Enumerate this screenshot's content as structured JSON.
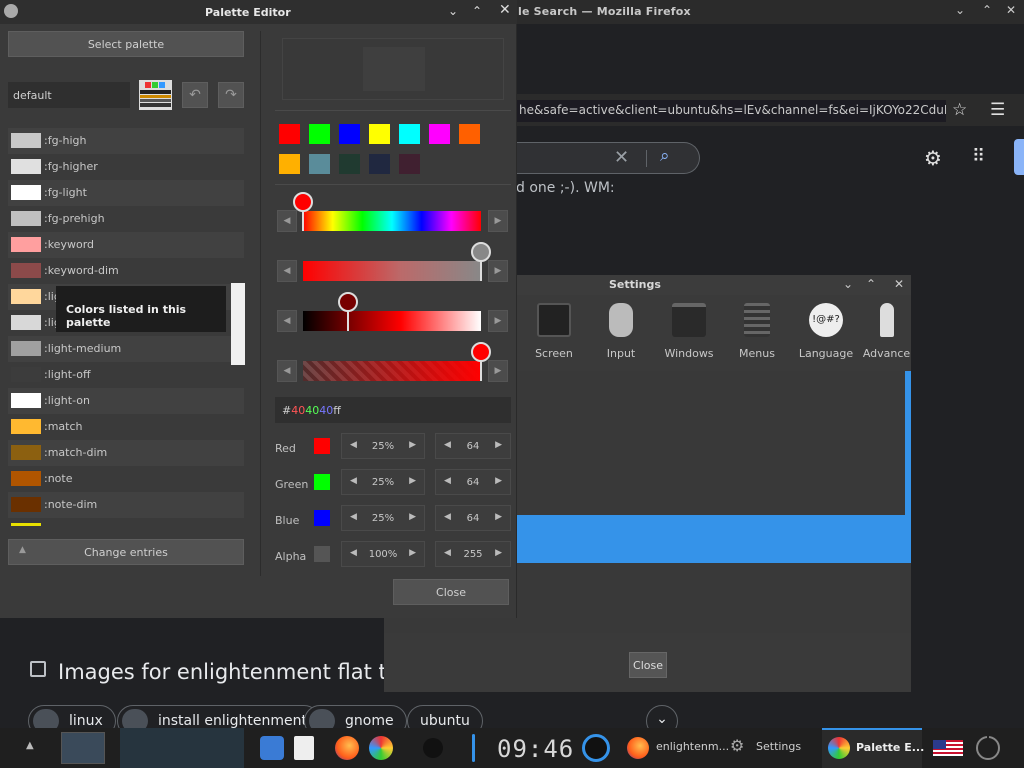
{
  "firefox": {
    "title": "le Search — Mozilla Firefox",
    "url": "he&safe=active&client=ubuntu&hs=lEv&channel=fs&ei=IjKOYo22CduHptQP",
    "body_text": "d one ;-). WM:",
    "images_heading": "Images for enlightenment flat the",
    "chips": [
      "linux",
      "install enlightenment",
      "gnome",
      "ubuntu"
    ]
  },
  "settings": {
    "title": "Settings",
    "items": [
      "Screen",
      "Input",
      "Windows",
      "Menus",
      "Language",
      "Advance"
    ],
    "close_label": "Close"
  },
  "palette_editor": {
    "title": "Palette Editor",
    "select_palette_label": "Select palette",
    "palette_name": "default",
    "entries": [
      {
        "name": ":fg-high",
        "color": "#c8c8c8"
      },
      {
        "name": ":fg-higher",
        "color": "#e0e0e0"
      },
      {
        "name": ":fg-light",
        "color": "#ffffff"
      },
      {
        "name": ":fg-prehigh",
        "color": "#c0c0c0"
      },
      {
        "name": ":keyword",
        "color": "#ff9f9f"
      },
      {
        "name": ":keyword-dim",
        "color": "#8c4a4a"
      },
      {
        "name": ":light-glow",
        "color": "#ffd79c"
      },
      {
        "name": ":light-high",
        "color": "#d8d8d8"
      },
      {
        "name": ":light-medium",
        "color": "#a0a0a0"
      },
      {
        "name": ":light-off",
        "color": "#3c3c3c"
      },
      {
        "name": ":light-on",
        "color": "#ffffff"
      },
      {
        "name": ":match",
        "color": "#ffb930"
      },
      {
        "name": ":match-dim",
        "color": "#8c6010"
      },
      {
        "name": ":note",
        "color": "#b05500"
      },
      {
        "name": ":note-dim",
        "color": "#6a3000"
      }
    ],
    "tooltip": "Colors listed in this palette",
    "change_entries_label": "Change entries",
    "quick_colors": [
      "#ff0000",
      "#00ff00",
      "#0000ff",
      "#ffff00",
      "#00ffff",
      "#ff00ff",
      "#ff6000",
      "#ffb000",
      "#5a8c9a",
      "#203a30",
      "#202840",
      "#402030"
    ],
    "hex_value": "#404040ff",
    "channels": [
      {
        "name": "Red",
        "color": "#ff0000",
        "percent": "25%",
        "value": "64"
      },
      {
        "name": "Green",
        "color": "#00ff00",
        "percent": "25%",
        "value": "64"
      },
      {
        "name": "Blue",
        "color": "#0000ff",
        "percent": "25%",
        "value": "64"
      },
      {
        "name": "Alpha",
        "color": "#555555",
        "percent": "100%",
        "value": "255"
      }
    ],
    "slider_levels": {
      "hue": 0.0,
      "saturation": 1.0,
      "value": 0.25,
      "alpha": 1.0
    },
    "close_label": "Close"
  },
  "taskbar": {
    "clock": "09:46",
    "tasks": [
      {
        "label": "enlightenm..."
      },
      {
        "label": "Settings"
      },
      {
        "label": "Palette E..."
      }
    ]
  }
}
